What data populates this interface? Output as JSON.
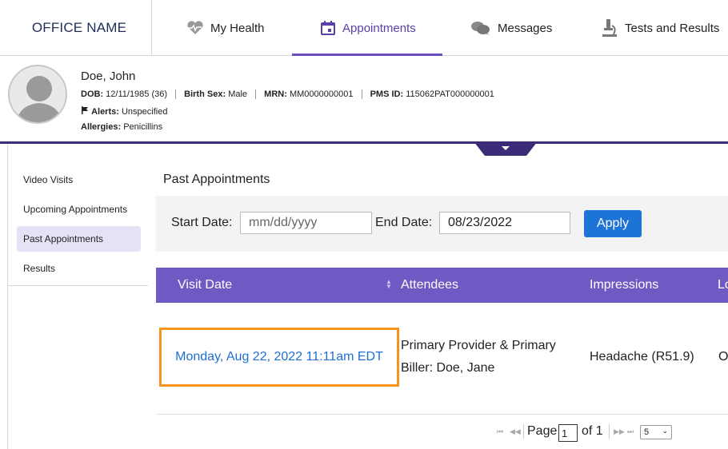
{
  "header": {
    "office_name": "OFFICE NAME",
    "tabs": [
      {
        "label": "My Health",
        "icon": "heart-pulse-icon"
      },
      {
        "label": "Appointments",
        "icon": "calendar-icon",
        "active": true
      },
      {
        "label": "Messages",
        "icon": "chat-bubbles-icon"
      },
      {
        "label": "Tests and Results",
        "icon": "microscope-icon"
      }
    ],
    "accent_color": "#5b3fa6"
  },
  "patient": {
    "name": "Doe, John",
    "dob_label": "DOB:",
    "dob_value": "12/11/1985 (36)",
    "sex_label": "Birth Sex:",
    "sex_value": "Male",
    "mrn_label": "MRN:",
    "mrn_value": "MM0000000001",
    "pms_label": "PMS ID:",
    "pms_value": "115062PAT000000001",
    "alerts_label": "Alerts:",
    "alerts_value": "Unspecified",
    "allergies_label": "Allergies:",
    "allergies_value": "Penicillins"
  },
  "sidebar": {
    "items": [
      {
        "label": "Video Visits"
      },
      {
        "label": "Upcoming Appointments"
      },
      {
        "label": "Past Appointments",
        "active": true
      },
      {
        "label": "Results"
      }
    ]
  },
  "main": {
    "title": "Past Appointments",
    "filters": {
      "start_label": "Start Date:",
      "start_placeholder": "mm/dd/yyyy",
      "end_label": "End Date:",
      "end_value": "08/23/2022",
      "apply_label": "Apply"
    },
    "table": {
      "columns": [
        "Visit Date",
        "Attendees",
        "Impressions",
        "Lo"
      ],
      "rows": [
        {
          "visit_date": "Monday, Aug 22, 2022 11:11am EDT",
          "attendees_line1": "Primary Provider & Primary",
          "attendees_line2": "Biller: Doe, Jane",
          "impressions": "Headache (R51.9)",
          "location": "O"
        }
      ]
    },
    "pager": {
      "page_label": "Page",
      "current_page": "1",
      "of_label": "of 1",
      "page_size": "5"
    }
  }
}
